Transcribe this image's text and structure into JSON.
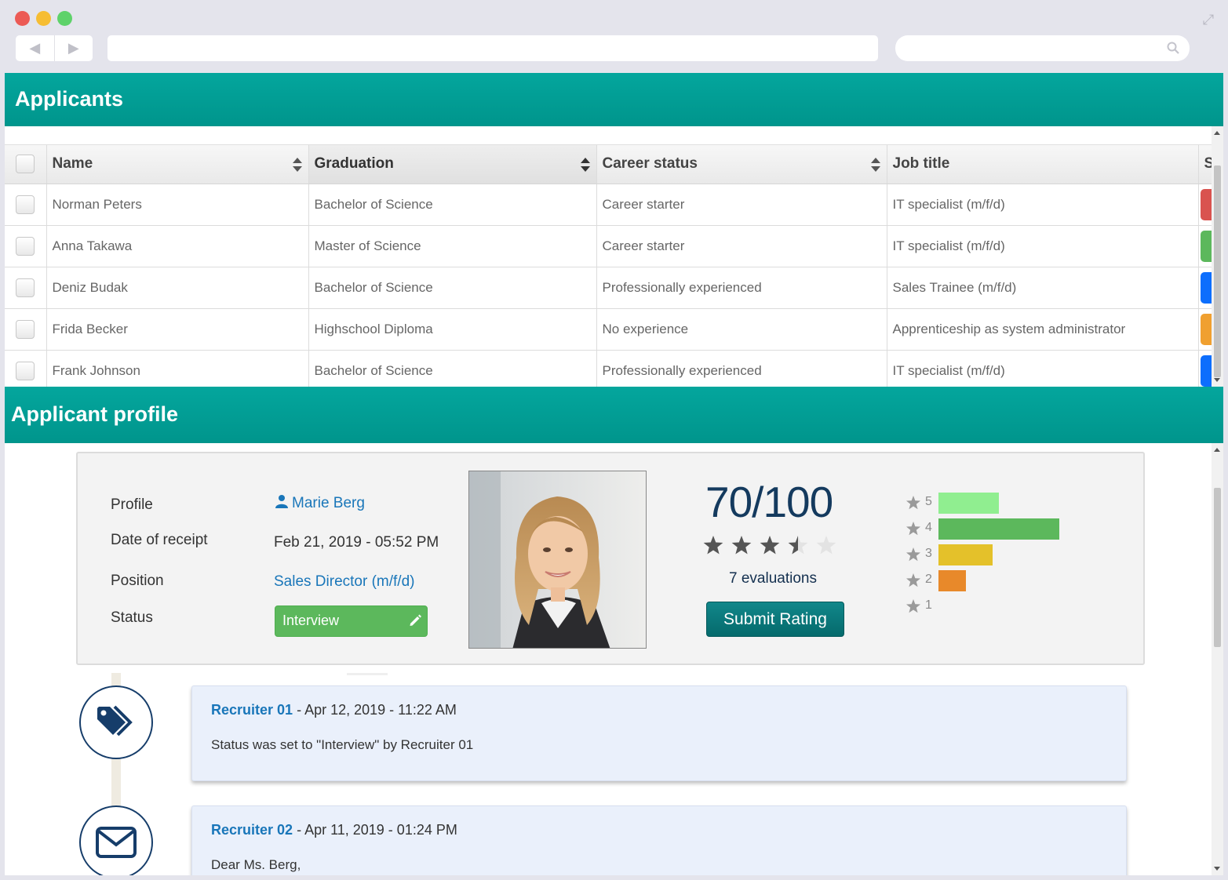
{
  "browser": {
    "back_icon": "back-arrow-icon",
    "forward_icon": "forward-arrow-icon",
    "search_icon": "search-icon",
    "expand_icon": "expand-icon"
  },
  "applicants": {
    "title": "Applicants",
    "columns": [
      "Name",
      "Graduation",
      "Career status",
      "Job title",
      "S"
    ],
    "rows": [
      {
        "name": "Norman Peters",
        "graduation": "Bachelor of Science",
        "career_status": "Career starter",
        "job_title": "IT specialist (m/f/d)",
        "status_color": "#d9534f"
      },
      {
        "name": "Anna Takawa",
        "graduation": "Master of Science",
        "career_status": "Career starter",
        "job_title": "IT specialist (m/f/d)",
        "status_color": "#5cb85c"
      },
      {
        "name": "Deniz Budak",
        "graduation": "Bachelor of Science",
        "career_status": "Professionally experienced",
        "job_title": "Sales Trainee (m/f/d)",
        "status_color": "#0d6efd"
      },
      {
        "name": "Frida Becker",
        "graduation": "Highschool Diploma",
        "career_status": "No experience",
        "job_title": "Apprenticeship as system administrator",
        "status_color": "#f0a030"
      },
      {
        "name": "Frank Johnson",
        "graduation": "Bachelor of Science",
        "career_status": "Professionally experienced",
        "job_title": "IT specialist (m/f/d)",
        "status_color": "#0d6efd"
      }
    ]
  },
  "profile": {
    "title": "Applicant profile",
    "labels": {
      "profile": "Profile",
      "date": "Date of receipt",
      "position": "Position",
      "status": "Status"
    },
    "name": "Marie Berg",
    "date": "Feb 21, 2019 - 05:52 PM",
    "position": "Sales Director (m/f/d)",
    "status": "Interview",
    "score": "70/100",
    "stars_rating": 3.5,
    "stars_max": 5,
    "evaluations": "7 evaluations",
    "submit_label": "Submit Rating",
    "distribution": [
      {
        "label": "5",
        "count": 2,
        "color": "#90ee90"
      },
      {
        "label": "4",
        "count": 4,
        "color": "#5cb85c"
      },
      {
        "label": "3",
        "count": 1.8,
        "color": "#e4c12a"
      },
      {
        "label": "2",
        "count": 0.9,
        "color": "#e8892a"
      },
      {
        "label": "1",
        "count": 0,
        "color": "#cccccc"
      }
    ]
  },
  "timeline": [
    {
      "icon": "tags-icon",
      "author": "Recruiter 01",
      "date": " - Apr 12, 2019 - 11:22 AM",
      "body": "Status was set to \"Interview\" by Recruiter 01"
    },
    {
      "icon": "envelope-icon",
      "author": "Recruiter 02",
      "date": " - Apr 11, 2019 - 01:24 PM",
      "body": "Dear Ms. Berg,"
    }
  ]
}
